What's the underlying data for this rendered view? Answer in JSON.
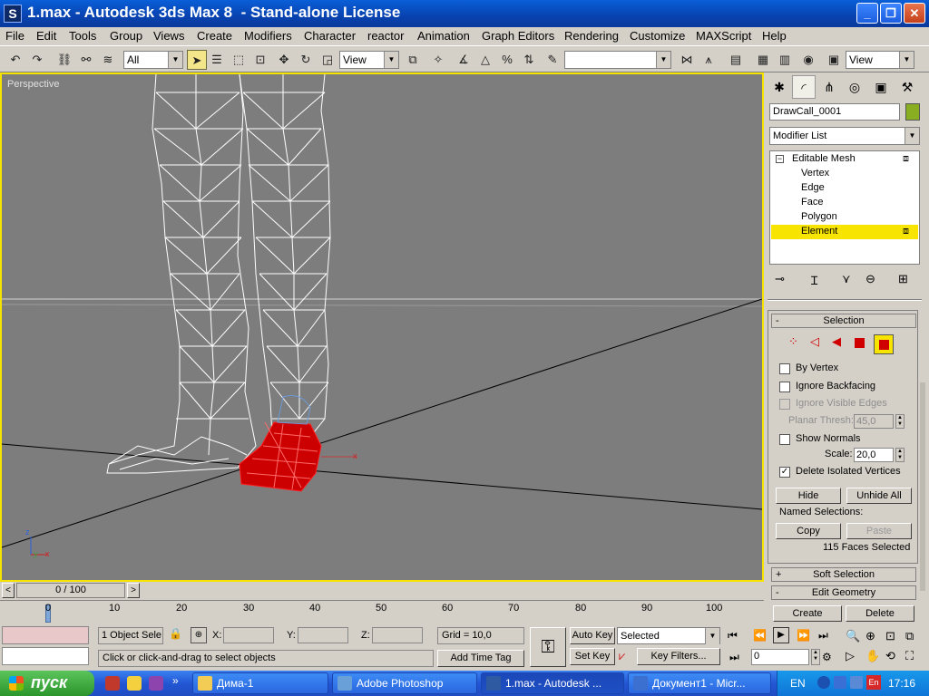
{
  "window": {
    "title": "1.max - Autodesk 3ds Max 8  - Stand-alone License",
    "app_icon": "3ds-max-logo-icon",
    "minimize": "_",
    "maximize": "❐",
    "close": "✕"
  },
  "menu": [
    "File",
    "Edit",
    "Tools",
    "Group",
    "Views",
    "Create",
    "Modifiers",
    "Character",
    "reactor",
    "Animation",
    "Graph Editors",
    "Rendering",
    "Customize",
    "MAXScript",
    "Help"
  ],
  "toolbar": {
    "selection_filter": "All",
    "ref_coord": "View",
    "named_sets": "",
    "view_combo_right": "View"
  },
  "viewport": {
    "label": "Perspective",
    "axis": {
      "z": "z",
      "y": "y",
      "x": "x"
    }
  },
  "command_panel": {
    "object_name": "DrawCall_0001",
    "object_color": "#8aae22",
    "modifier_list": "Modifier List",
    "stack": {
      "root": "Editable Mesh",
      "items": [
        "Vertex",
        "Edge",
        "Face",
        "Polygon",
        "Element"
      ],
      "selected": "Element"
    },
    "selection": {
      "title": "Selection",
      "by_vertex": "By Vertex",
      "ignore_backfacing": "Ignore Backfacing",
      "ignore_visible_edges": "Ignore Visible Edges",
      "planar_thresh_label": "Planar Thresh:",
      "planar_thresh": "45,0",
      "show_normals": "Show Normals",
      "scale_label": "Scale:",
      "scale": "20,0",
      "delete_isolated": "Delete Isolated Vertices",
      "hide": "Hide",
      "unhide_all": "Unhide All",
      "named_selections": "Named Selections:",
      "copy": "Copy",
      "paste": "Paste",
      "status": "115 Faces Selected"
    },
    "soft_selection": "Soft Selection",
    "edit_geometry": "Edit Geometry",
    "create": "Create",
    "delete": "Delete"
  },
  "timeslider": {
    "frame": "0 / 100",
    "prev": "<",
    "next": ">"
  },
  "ruler": {
    "ticks": [
      "0",
      "10",
      "20",
      "30",
      "40",
      "50",
      "60",
      "70",
      "80",
      "90",
      "100"
    ]
  },
  "status": {
    "objects": "1 Object Sele",
    "x_label": "X:",
    "y_label": "Y:",
    "z_label": "Z:",
    "grid": "Grid = 10,0",
    "prompt": "Click or click-and-drag to select objects",
    "add_time_tag": "Add Time Tag",
    "auto_key": "Auto Key",
    "set_key": "Set Key",
    "key_mode": "Selected",
    "key_filters": "Key Filters...",
    "frame": "0"
  },
  "taskbar": {
    "start": "пуск",
    "tasks": [
      {
        "label": "Дима-1",
        "icon": "folder-icon",
        "color": "#f2cc55"
      },
      {
        "label": "Adobe Photoshop",
        "icon": "photoshop-icon",
        "color": "#6aa0d8"
      },
      {
        "label": "1.max - Autodesk ...",
        "icon": "3ds-max-icon",
        "color": "#2d5aa0"
      },
      {
        "label": "Документ1 - Micr...",
        "icon": "word-icon",
        "color": "#3b6fd0"
      }
    ],
    "lang": "EN",
    "time": "17:16"
  }
}
